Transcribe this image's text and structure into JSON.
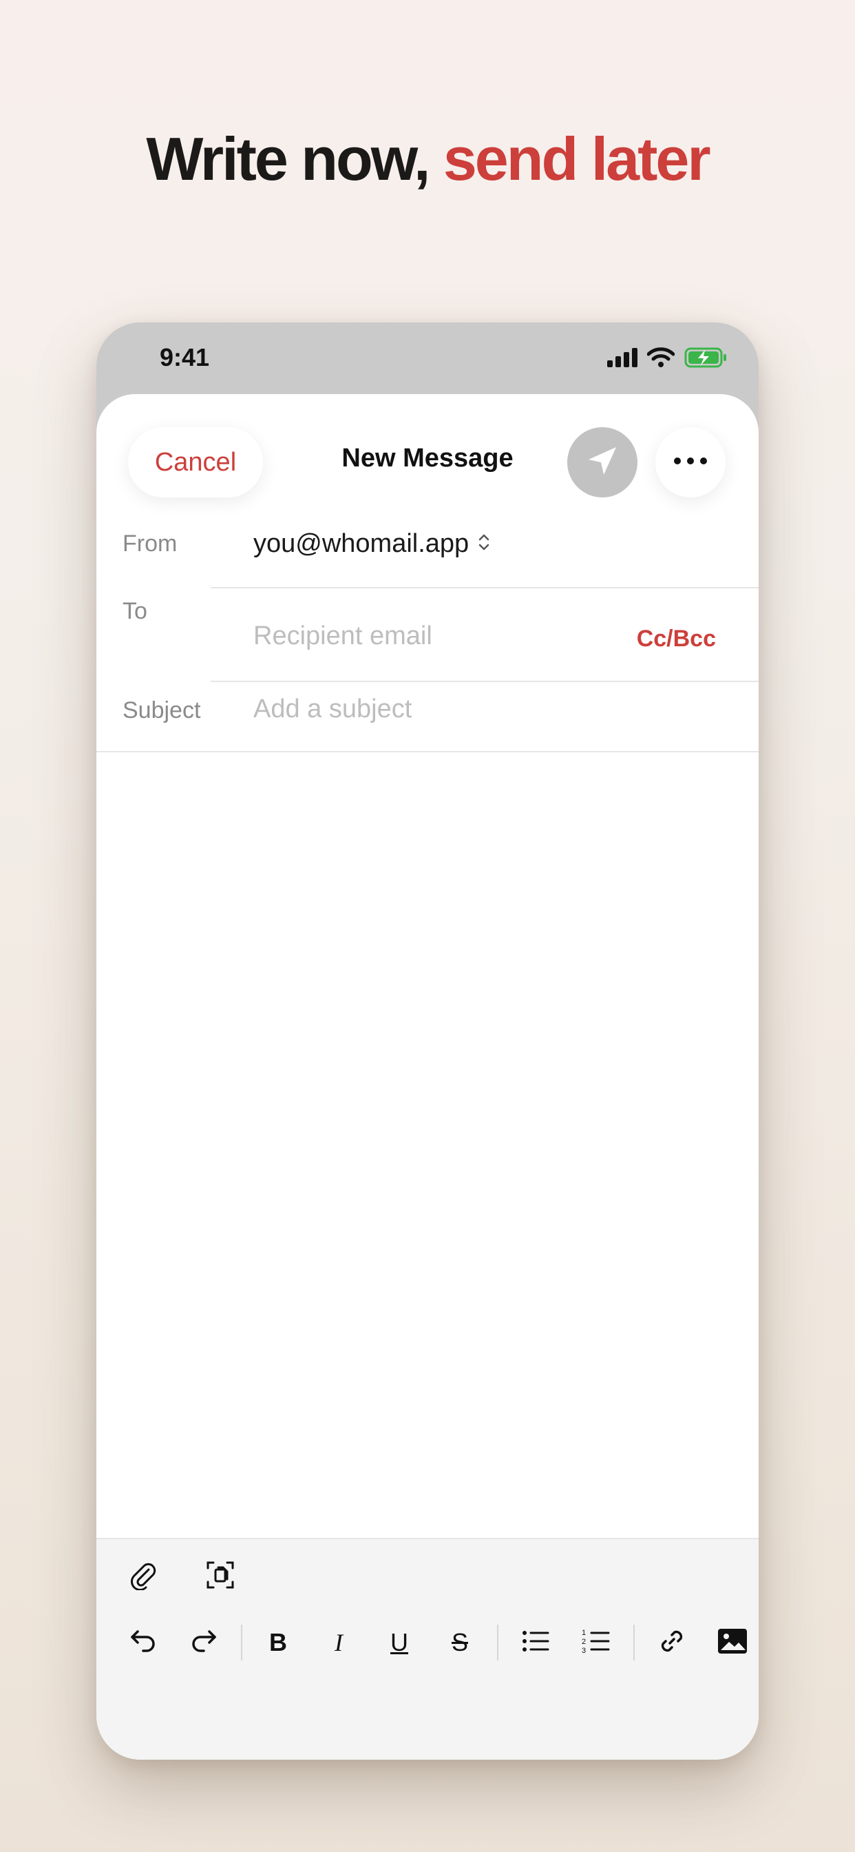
{
  "headline": {
    "part1": "Write now, ",
    "part2": "send later"
  },
  "status_bar": {
    "time": "9:41",
    "icons": [
      "cellular-signal-icon",
      "wifi-icon",
      "battery-charging-icon"
    ]
  },
  "compose": {
    "cancel_label": "Cancel",
    "title": "New Message",
    "send_icon": "paper-plane-icon",
    "more_icon": "ellipsis-icon",
    "from": {
      "label": "From",
      "value": "you@whomail.app"
    },
    "to": {
      "label": "To",
      "placeholder": "Recipient email",
      "ccbcc_label": "Cc/Bcc"
    },
    "subject": {
      "label": "Subject",
      "placeholder": "Add a subject"
    }
  },
  "toolbar": {
    "top_row": [
      "paperclip-icon",
      "scan-document-icon"
    ],
    "format_row": [
      "undo-icon",
      "redo-icon",
      "bold-icon",
      "italic-icon",
      "underline-icon",
      "strikethrough-icon",
      "bullet-list-icon",
      "numbered-list-icon",
      "link-icon",
      "image-icon"
    ],
    "bold": "B",
    "italic": "I",
    "underline": "U",
    "strikethrough": "S"
  },
  "colors": {
    "accent": "#cc3f3b",
    "send_button_disabled": "#c2c2c2",
    "battery": "#3bb54a"
  }
}
